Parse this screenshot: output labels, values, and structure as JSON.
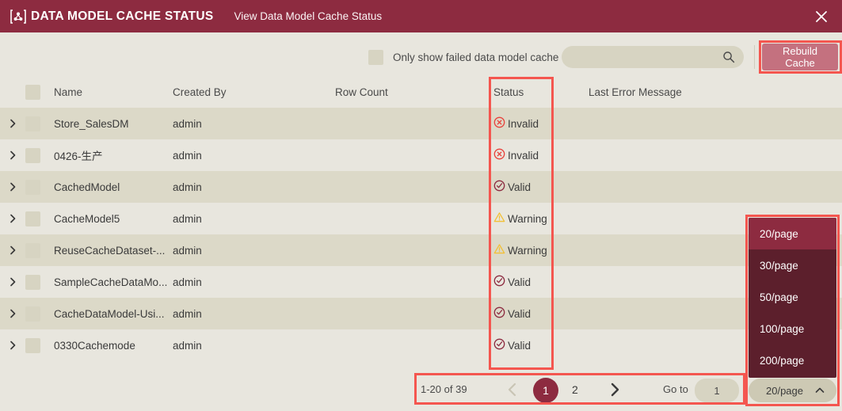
{
  "header": {
    "logo_icon": "data-model-bracket-icon",
    "title": "DATA MODEL CACHE STATUS",
    "subtitle": "View Data Model Cache Status",
    "close_icon": "close-icon",
    "bg_color": "#8d2b40"
  },
  "toolbar": {
    "filter_checkbox_label": "Only show failed data model cache",
    "filter_checked": false,
    "search_value": "",
    "search_placeholder": "",
    "search_icon": "search-icon",
    "rebuild_button_label": "Rebuild Cache",
    "rebuild_button_color": "#c4717f",
    "annotation_color": "#f4564f"
  },
  "table": {
    "columns": [
      {
        "key": "name",
        "label": "Name"
      },
      {
        "key": "created_by",
        "label": "Created By"
      },
      {
        "key": "row_count",
        "label": "Row Count"
      },
      {
        "key": "status",
        "label": "Status"
      },
      {
        "key": "last_error",
        "label": "Last Error Message"
      }
    ],
    "rows": [
      {
        "name": "Store_SalesDM",
        "created_by": "admin",
        "row_count": "",
        "status": "Invalid",
        "status_icon": "error-circle-x-icon",
        "last_error": ""
      },
      {
        "name": "0426-生产",
        "created_by": "admin",
        "row_count": "",
        "status": "Invalid",
        "status_icon": "error-circle-x-icon",
        "last_error": ""
      },
      {
        "name": "CachedModel",
        "created_by": "admin",
        "row_count": "",
        "status": "Valid",
        "status_icon": "success-circle-check-icon",
        "last_error": ""
      },
      {
        "name": "CacheModel5",
        "created_by": "admin",
        "row_count": "",
        "status": "Warning",
        "status_icon": "warning-triangle-icon",
        "last_error": ""
      },
      {
        "name": "ReuseCacheDataset-...",
        "created_by": "admin",
        "row_count": "",
        "status": "Warning",
        "status_icon": "warning-triangle-icon",
        "last_error": ""
      },
      {
        "name": "SampleCacheDataMo...",
        "created_by": "admin",
        "row_count": "",
        "status": "Valid",
        "status_icon": "success-circle-check-icon",
        "last_error": ""
      },
      {
        "name": "CacheDataModel-Usi...",
        "created_by": "admin",
        "row_count": "",
        "status": "Valid",
        "status_icon": "success-circle-check-icon",
        "last_error": ""
      },
      {
        "name": "0330Cachemode",
        "created_by": "admin",
        "row_count": "",
        "status": "Valid",
        "status_icon": "success-circle-check-icon",
        "last_error": ""
      }
    ],
    "status_colors": {
      "Invalid": "#e8423c",
      "Valid": "#8d2b40",
      "Warning": "#f2c037"
    }
  },
  "pagination": {
    "summary": "1-20 of 39",
    "prev_icon": "chevron-left-icon",
    "next_icon": "chevron-right-icon",
    "pages": [
      "1",
      "2"
    ],
    "active_page": "1",
    "goto_label": "Go to",
    "goto_value": "1"
  },
  "page_size": {
    "selected": "20/page",
    "caret_icon": "chevron-up-icon",
    "options": [
      "20/page",
      "30/page",
      "50/page",
      "100/page",
      "200/page"
    ],
    "menu_bg": "#5c1f2c",
    "selected_bg": "#8d2b40"
  }
}
